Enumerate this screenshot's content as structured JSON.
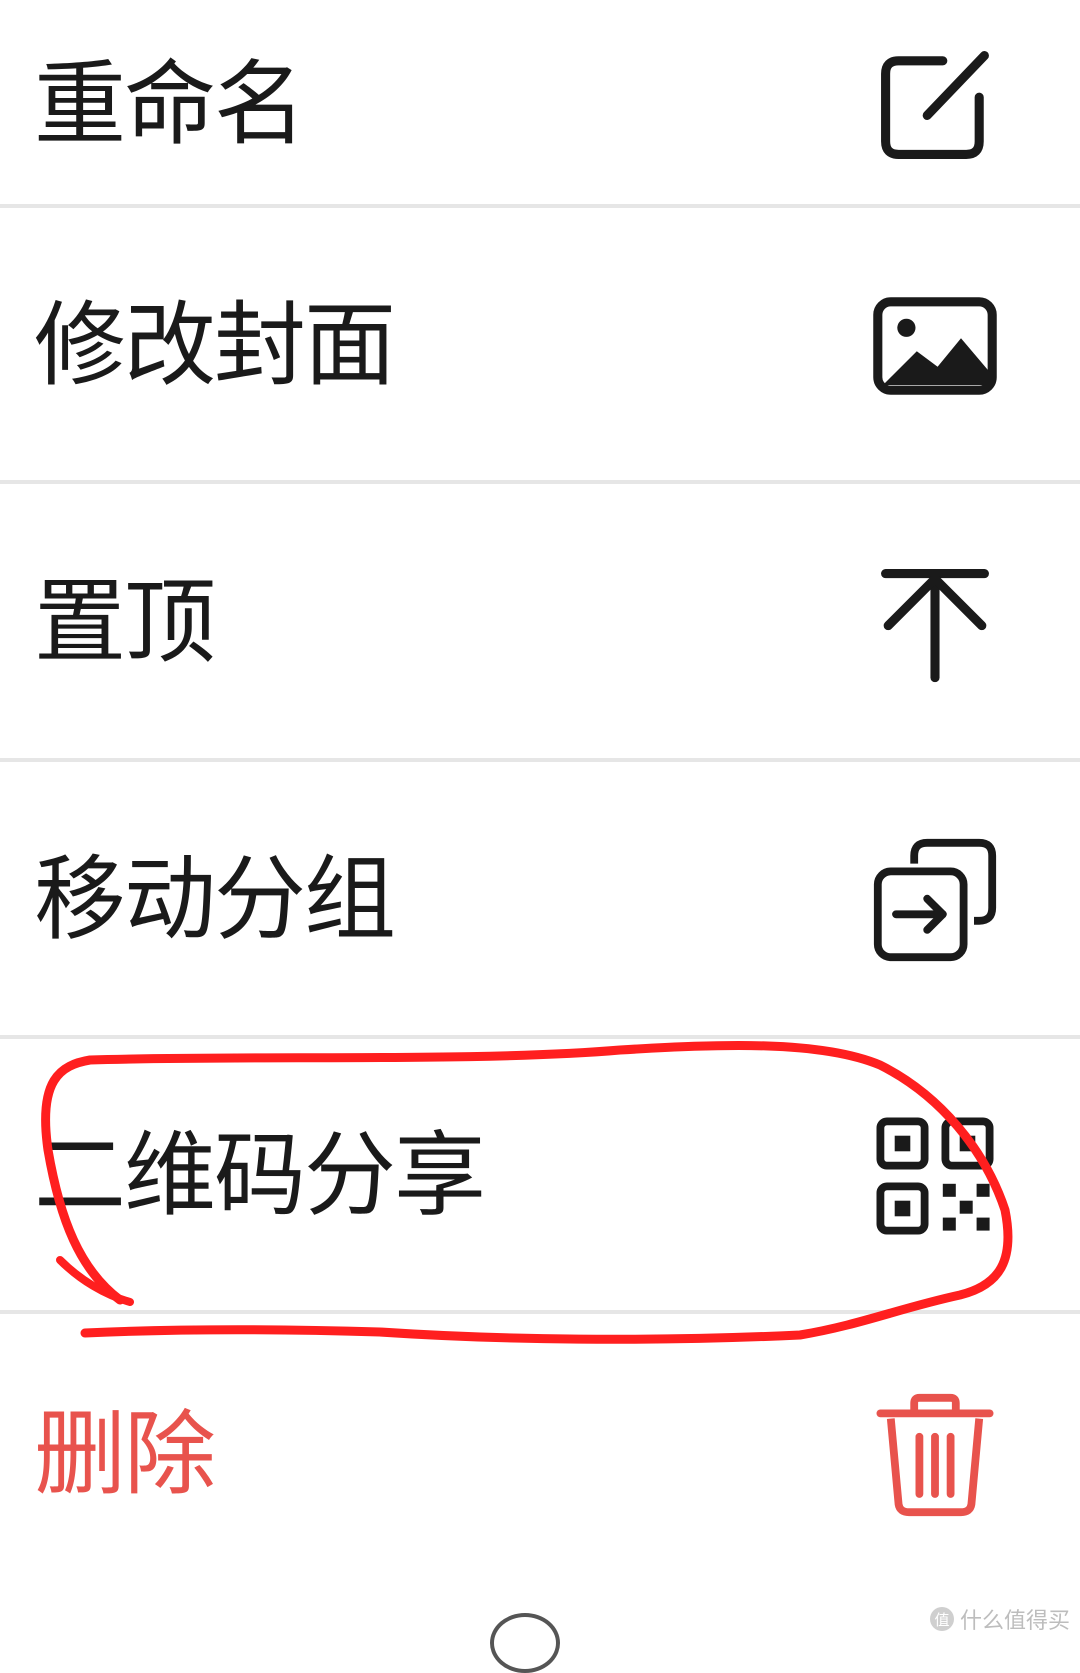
{
  "menu": {
    "items": [
      {
        "label": "重命名",
        "icon": "edit-icon"
      },
      {
        "label": "修改封面",
        "icon": "image-icon"
      },
      {
        "label": "置顶",
        "icon": "pin-top-icon"
      },
      {
        "label": "移动分组",
        "icon": "move-group-icon"
      },
      {
        "label": "二维码分享",
        "icon": "qr-code-icon"
      },
      {
        "label": "删除",
        "icon": "trash-icon"
      }
    ]
  },
  "annotation": {
    "color": "#ff1f1f",
    "target": "qr-share-item"
  },
  "colors": {
    "text": "#1a1a1a",
    "danger": "#e8534d",
    "divider": "#e6e6e6",
    "background": "#ffffff"
  },
  "watermark": {
    "text": "什么值得买",
    "icon": "值"
  }
}
